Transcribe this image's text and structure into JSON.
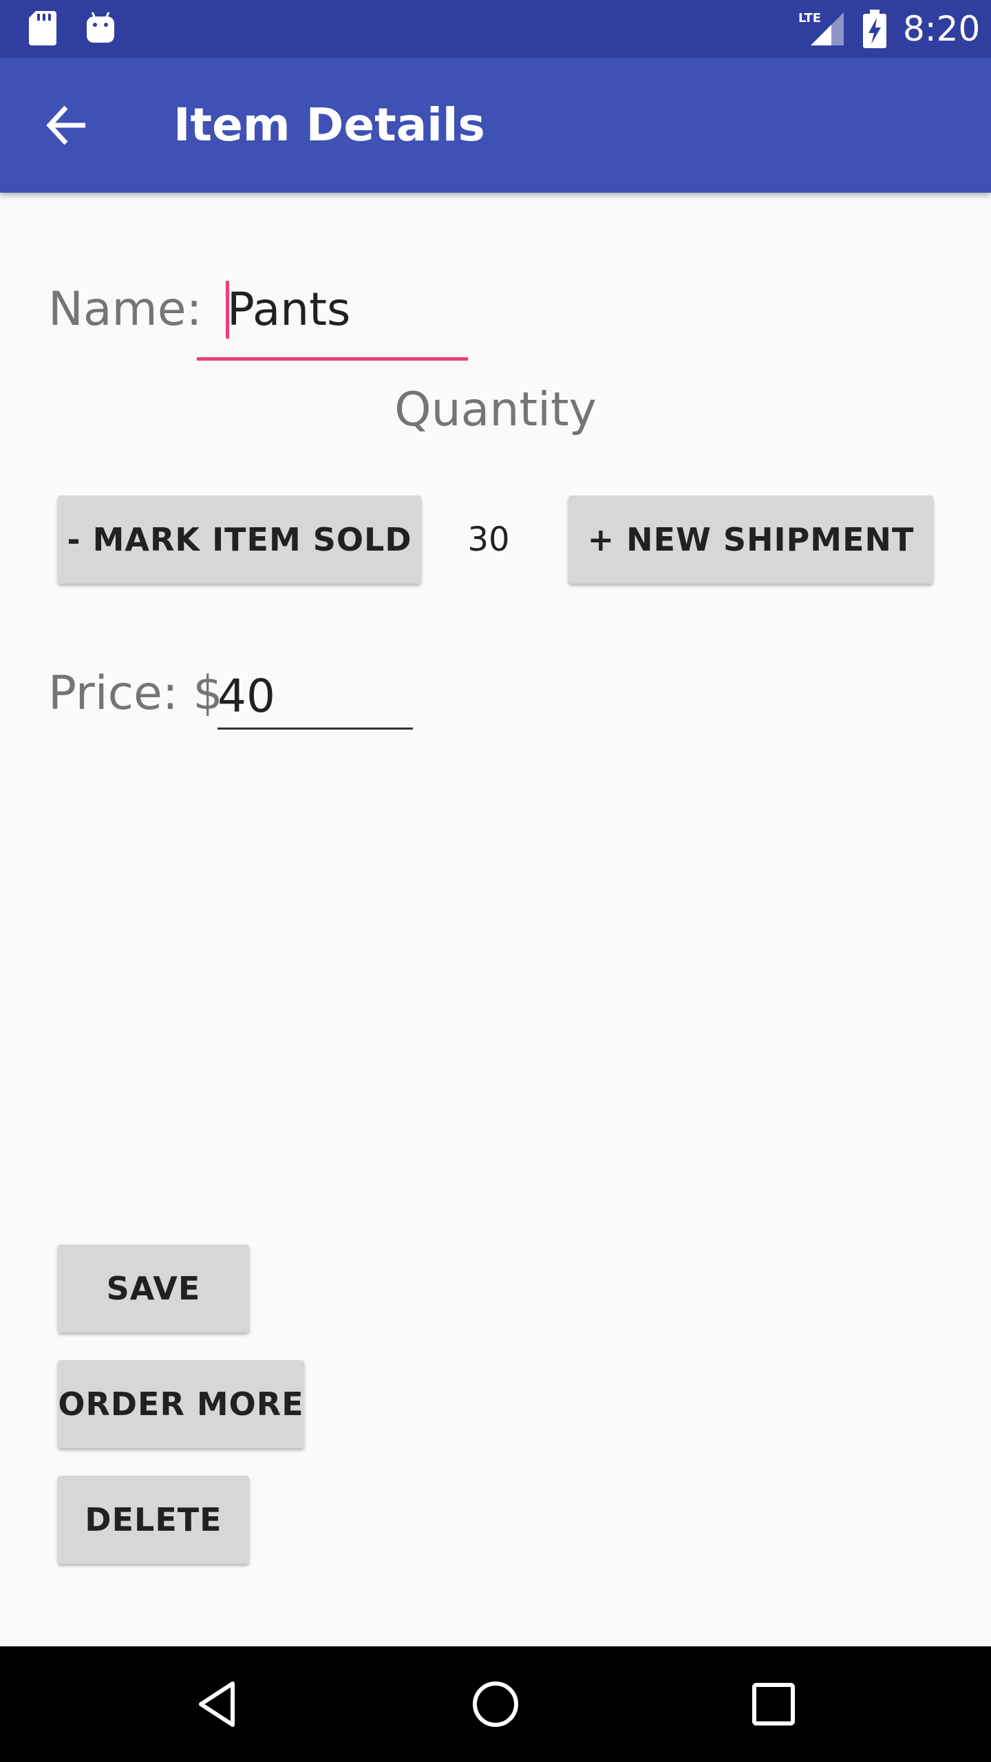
{
  "status_bar": {
    "time": "8:20",
    "network": "LTE",
    "icons": [
      "sd-card-icon",
      "android-icon",
      "lte-signal-icon",
      "battery-charging-icon"
    ]
  },
  "app_bar": {
    "title": "Item Details",
    "back_icon": "arrow-back-icon"
  },
  "form": {
    "name_label": "Name:",
    "name_value": "Pants",
    "quantity_label": "Quantity",
    "mark_sold_label": "- MARK ITEM SOLD",
    "quantity_value": "30",
    "new_shipment_label": "+ NEW SHIPMENT",
    "price_label": "Price: $",
    "price_value": "40"
  },
  "actions": {
    "save_label": "SAVE",
    "order_more_label": "ORDER MORE",
    "delete_label": "DELETE"
  },
  "nav_bar": {
    "icons": [
      "nav-back-icon",
      "nav-home-icon",
      "nav-recents-icon"
    ]
  },
  "colors": {
    "status_bar": "#303f9f",
    "app_bar": "#3f51b5",
    "accent": "#ec407a",
    "button": "#d6d7d7",
    "background": "#fafafa"
  }
}
